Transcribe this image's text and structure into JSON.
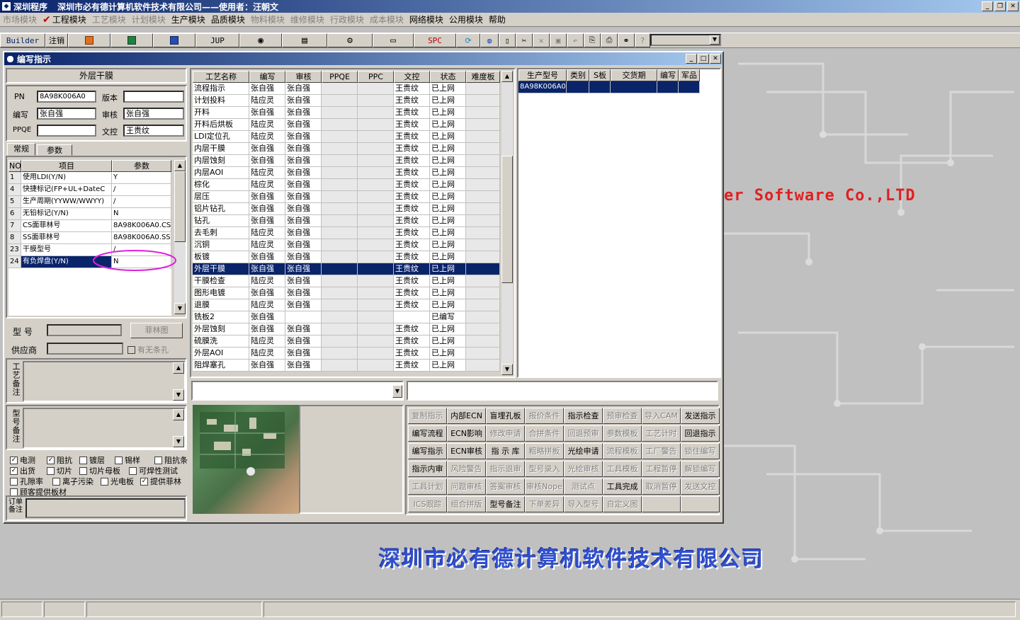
{
  "app": {
    "title_program": "深圳程序",
    "title_company": "深圳市必有德计算机软件技术有限公司——使用者：汪朝文"
  },
  "menus": [
    {
      "label": "市场模块",
      "enabled": false
    },
    {
      "label": "工程模块",
      "enabled": true,
      "checked": true
    },
    {
      "label": "工艺模块",
      "enabled": false
    },
    {
      "label": "计划模块",
      "enabled": false
    },
    {
      "label": "生产模块",
      "enabled": true
    },
    {
      "label": "品质模块",
      "enabled": true
    },
    {
      "label": "物料模块",
      "enabled": false
    },
    {
      "label": "维修模块",
      "enabled": false
    },
    {
      "label": "行政模块",
      "enabled": false
    },
    {
      "label": "成本模块",
      "enabled": false
    },
    {
      "label": "网络模块",
      "enabled": true
    },
    {
      "label": "公用模块",
      "enabled": true
    },
    {
      "label": "帮助",
      "enabled": true
    }
  ],
  "toolbar": {
    "builder": "Builder",
    "logout": "注销",
    "jup": "JUP",
    "spc": "SPC"
  },
  "background": {
    "software_text": "er Software Co.,LTD",
    "company_text": "深圳市必有德计算机软件技术有限公司"
  },
  "child": {
    "title": "编写指示",
    "left": {
      "section_title": "外层干膜",
      "pn_label": "PN",
      "pn_value": "8A98K006A0",
      "version_label": "版本",
      "version_value": "",
      "writer_label": "编写",
      "writer_value": "张自强",
      "reviewer_label": "审核",
      "reviewer_value": "张自强",
      "ppqe_label": "PPQE",
      "ppqe_value": "",
      "doc_label": "文控",
      "doc_value": "王贵纹",
      "tabs": [
        "常规",
        "参数"
      ],
      "param_headers": [
        "NO",
        "项目",
        "参数"
      ],
      "params": [
        {
          "no": "1",
          "item": "使用LDI(Y/N)",
          "value": "Y"
        },
        {
          "no": "4",
          "item": "快捷标记(FP+UL+DateC",
          "value": "/"
        },
        {
          "no": "5",
          "item": "生产周期(YYWW/WWYY)",
          "value": "/"
        },
        {
          "no": "6",
          "item": "无铅标记(Y/N)",
          "value": "N"
        },
        {
          "no": "7",
          "item": "CS面菲林号",
          "value": "8A98K006A0.CS"
        },
        {
          "no": "8",
          "item": "SS面菲林号",
          "value": "8A98K006A0.SS"
        },
        {
          "no": "23",
          "item": "干膜型号",
          "value": "/"
        },
        {
          "no": "24",
          "item": "有负焊盘(Y/N)",
          "value": "N"
        }
      ],
      "model_label": "型  号",
      "film_button": "菲林图",
      "supplier_label": "供应商",
      "no_barcode_label": "有无条孔",
      "process_note_label": "工艺备注",
      "model_note_label": "型号备注",
      "checkboxes": [
        {
          "label": "电测",
          "checked": true
        },
        {
          "label": "阻抗",
          "checked": true
        },
        {
          "label": "镀层",
          "checked": false
        },
        {
          "label": "锡样",
          "checked": false
        },
        {
          "label": "阻抗条",
          "checked": false
        },
        {
          "label": "出货",
          "checked": true
        },
        {
          "label": "切片",
          "checked": false
        },
        {
          "label": "切片母板",
          "checked": false
        },
        {
          "label": "可焊性测试",
          "checked": false
        },
        {
          "label": "孔隙率",
          "checked": false
        },
        {
          "label": "离子污染",
          "checked": false
        },
        {
          "label": "光电板",
          "checked": false
        },
        {
          "label": "提供菲林",
          "checked": true
        },
        {
          "label": "顾客提供板材",
          "checked": false
        }
      ],
      "order_note_label": "订单备注"
    },
    "process_grid": {
      "headers": [
        "工艺名称",
        "编写",
        "审核",
        "PPQE",
        "PPC",
        "文控",
        "状态",
        "难度板"
      ],
      "rows": [
        [
          "流程指示",
          "张自强",
          "张自强",
          "",
          "",
          "王贵纹",
          "已上网",
          ""
        ],
        [
          "计划投料",
          "陆应灵",
          "张自强",
          "",
          "",
          "王贵纹",
          "已上网",
          ""
        ],
        [
          "开料",
          "张自强",
          "张自强",
          "",
          "",
          "王贵纹",
          "已上网",
          ""
        ],
        [
          "开料后烘板",
          "陆应灵",
          "张自强",
          "",
          "",
          "王贵纹",
          "已上网",
          ""
        ],
        [
          "LDI定位孔",
          "陆应灵",
          "张自强",
          "",
          "",
          "王贵纹",
          "已上网",
          ""
        ],
        [
          "内层干膜",
          "张自强",
          "张自强",
          "",
          "",
          "王贵纹",
          "已上网",
          ""
        ],
        [
          "内层蚀刻",
          "张自强",
          "张自强",
          "",
          "",
          "王贵纹",
          "已上网",
          ""
        ],
        [
          "内层AOI",
          "陆应灵",
          "张自强",
          "",
          "",
          "王贵纹",
          "已上网",
          ""
        ],
        [
          "棕化",
          "陆应灵",
          "张自强",
          "",
          "",
          "王贵纹",
          "已上网",
          ""
        ],
        [
          "层压",
          "张自强",
          "张自强",
          "",
          "",
          "王贵纹",
          "已上网",
          ""
        ],
        [
          "铝片钻孔",
          "张自强",
          "张自强",
          "",
          "",
          "王贵纹",
          "已上网",
          ""
        ],
        [
          "钻孔",
          "张自强",
          "张自强",
          "",
          "",
          "王贵纹",
          "已上网",
          ""
        ],
        [
          "去毛刺",
          "陆应灵",
          "张自强",
          "",
          "",
          "王贵纹",
          "已上网",
          ""
        ],
        [
          "沉铜",
          "陆应灵",
          "张自强",
          "",
          "",
          "王贵纹",
          "已上网",
          ""
        ],
        [
          "板镀",
          "张自强",
          "张自强",
          "",
          "",
          "王贵纹",
          "已上网",
          ""
        ],
        [
          "外层干膜",
          "张自强",
          "张自强",
          "",
          "",
          "王贵纹",
          "已上网",
          ""
        ],
        [
          "干膜检查",
          "陆应灵",
          "张自强",
          "",
          "",
          "王贵纹",
          "已上网",
          ""
        ],
        [
          "图形电镀",
          "张自强",
          "张自强",
          "",
          "",
          "王贵纹",
          "已上网",
          ""
        ],
        [
          "退膜",
          "陆应灵",
          "张自强",
          "",
          "",
          "王贵纹",
          "已上网",
          ""
        ],
        [
          "铣板2",
          "张自强",
          "",
          "",
          "",
          "",
          "已编写",
          ""
        ],
        [
          "外层蚀刻",
          "张自强",
          "张自强",
          "",
          "",
          "王贵纹",
          "已上网",
          ""
        ],
        [
          "硫膜洗",
          "陆应灵",
          "张自强",
          "",
          "",
          "王贵纹",
          "已上网",
          ""
        ],
        [
          "外层AOI",
          "陆应灵",
          "张自强",
          "",
          "",
          "王贵纹",
          "已上网",
          ""
        ],
        [
          "阻焊塞孔",
          "张自强",
          "张自强",
          "",
          "",
          "王贵纹",
          "已上网",
          ""
        ]
      ],
      "selected_index": 15
    },
    "model_grid": {
      "headers": [
        "生产型号",
        "类别",
        "S板",
        "交货期",
        "编写",
        "军品"
      ],
      "rows": [
        [
          "8A98K006A0",
          "",
          "",
          "",
          "",
          ""
        ]
      ]
    },
    "action_buttons": [
      [
        {
          "label": "复制指示",
          "enabled": false
        },
        {
          "label": "内部ECN",
          "enabled": true
        },
        {
          "label": "盲埋孔板",
          "enabled": true
        },
        {
          "label": "报价条件",
          "enabled": false
        },
        {
          "label": "指示检查",
          "enabled": true
        },
        {
          "label": "预审检查",
          "enabled": false
        },
        {
          "label": "导入CAM",
          "enabled": false
        },
        {
          "label": "发送指示",
          "enabled": true
        }
      ],
      [
        {
          "label": "编写流程",
          "enabled": true
        },
        {
          "label": "ECN影响",
          "enabled": true
        },
        {
          "label": "修改申请",
          "enabled": false
        },
        {
          "label": "合拼条件",
          "enabled": false
        },
        {
          "label": "回退预审",
          "enabled": false
        },
        {
          "label": "参数模板",
          "enabled": false
        },
        {
          "label": "工艺计时",
          "enabled": false
        },
        {
          "label": "回退指示",
          "enabled": true
        }
      ],
      [
        {
          "label": "编写指示",
          "enabled": true
        },
        {
          "label": "ECN审核",
          "enabled": true
        },
        {
          "label": "指 示 库",
          "enabled": true
        },
        {
          "label": "粗略拼板",
          "enabled": false
        },
        {
          "label": "光绘申请",
          "enabled": true
        },
        {
          "label": "流程模板",
          "enabled": false
        },
        {
          "label": "工厂警告",
          "enabled": false
        },
        {
          "label": "锁住编写",
          "enabled": false
        }
      ],
      [
        {
          "label": "指示内审",
          "enabled": true
        },
        {
          "label": "风险警告",
          "enabled": false
        },
        {
          "label": "指示退审",
          "enabled": false
        },
        {
          "label": "型号录入",
          "enabled": false
        },
        {
          "label": "光绘审核",
          "enabled": false
        },
        {
          "label": "工具模板",
          "enabled": false
        },
        {
          "label": "工程暂停",
          "enabled": false
        },
        {
          "label": "解锁编写",
          "enabled": false
        }
      ],
      [
        {
          "label": "工具计划",
          "enabled": false
        },
        {
          "label": "问题审核",
          "enabled": false
        },
        {
          "label": "答案审核",
          "enabled": false
        },
        {
          "label": "审核Nope",
          "enabled": false
        },
        {
          "label": "测试点",
          "enabled": false
        },
        {
          "label": "工具完成",
          "enabled": true
        },
        {
          "label": "取消暂停",
          "enabled": false
        },
        {
          "label": "发送文控",
          "enabled": false
        }
      ],
      [
        {
          "label": "ICS跟踪",
          "enabled": false
        },
        {
          "label": "组合拼版",
          "enabled": false
        },
        {
          "label": "型号备注",
          "enabled": true
        },
        {
          "label": "下单差异",
          "enabled": false
        },
        {
          "label": "导入型号",
          "enabled": false
        },
        {
          "label": "自定义图",
          "enabled": false
        },
        {
          "label": "",
          "enabled": false
        },
        {
          "label": "",
          "enabled": false
        }
      ]
    ]
  },
  "colors": {
    "title_active": "#0a246a",
    "selection": "#0a246a",
    "face": "#d4d0c8",
    "desktop": "#c0c0c0",
    "highlight_ellipse": "#e020e0"
  }
}
